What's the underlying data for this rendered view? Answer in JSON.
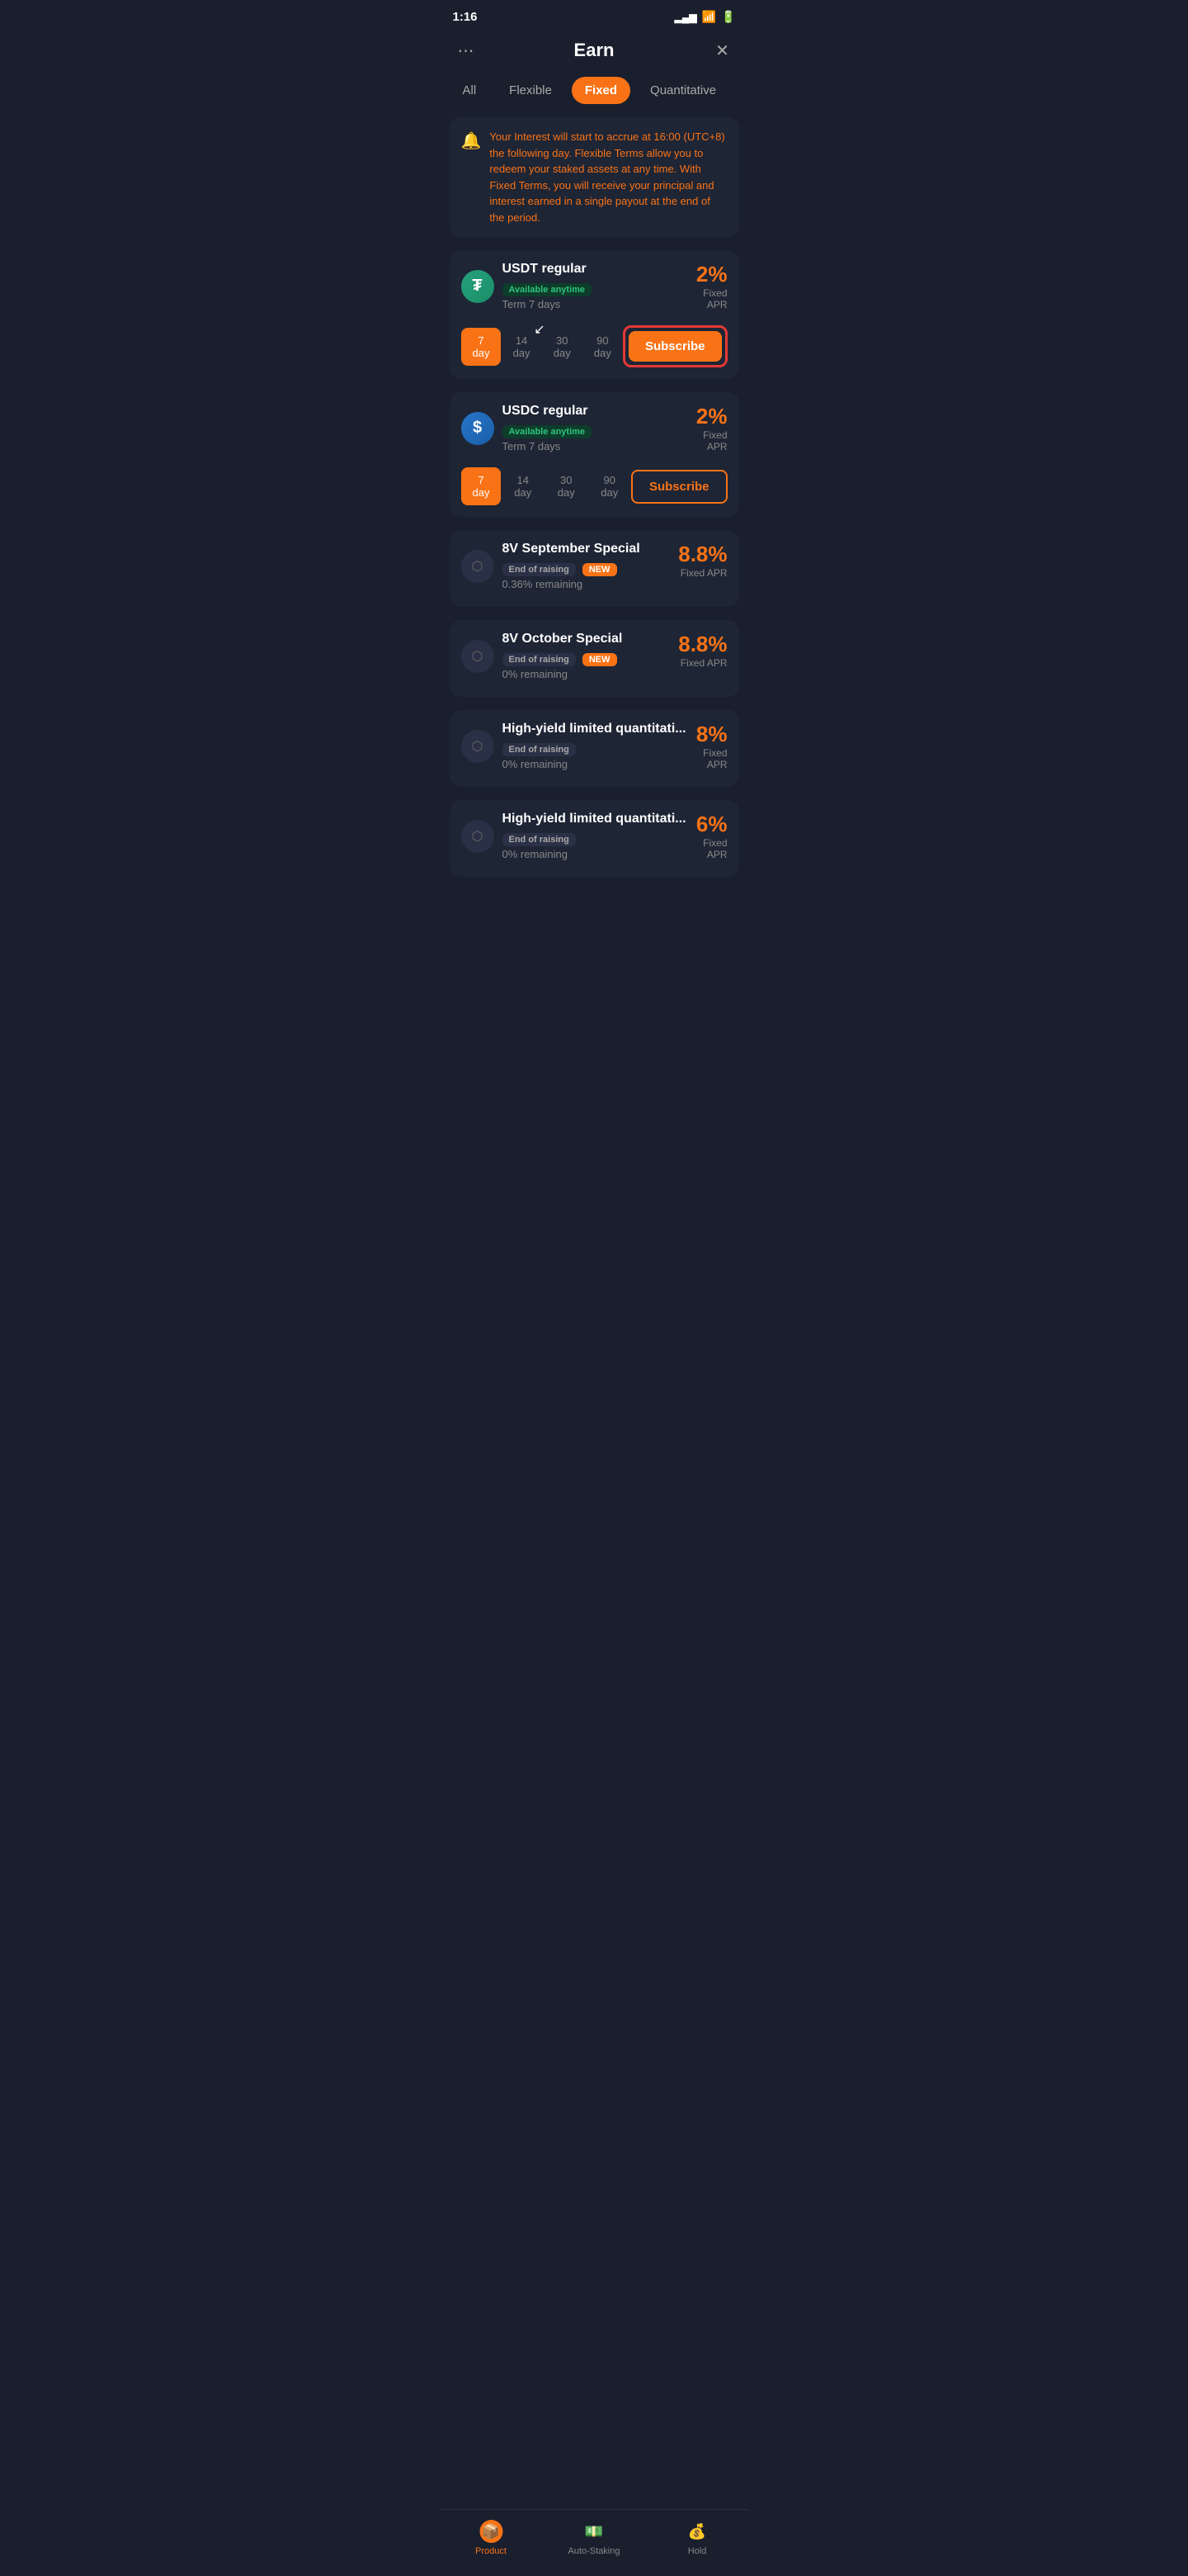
{
  "statusBar": {
    "time": "1:16",
    "icons": [
      "signal",
      "wifi",
      "battery"
    ]
  },
  "header": {
    "title": "Earn",
    "moreIcon": "⋯",
    "closeIcon": "✕"
  },
  "tabs": [
    {
      "id": "all",
      "label": "All",
      "active": false
    },
    {
      "id": "flexible",
      "label": "Flexible",
      "active": false
    },
    {
      "id": "fixed",
      "label": "Fixed",
      "active": true
    },
    {
      "id": "quantitative",
      "label": "Quantitative",
      "active": false
    }
  ],
  "notice": {
    "icon": "🔔",
    "text": "Your Interest will start to accrue at 16:00 (UTC+8) the following day. Flexible Terms allow you to redeem your staked assets at any time. With Fixed Terms, you will receive your principal and interest earned in a single payout at the end of the period."
  },
  "products": [
    {
      "id": "usdt-regular",
      "logo": "usdt",
      "name": "USDT regular",
      "badge": "Available anytime",
      "badgeType": "available",
      "apr": "2%",
      "aprLabel": "Fixed APR",
      "term": "Term 7 days",
      "days": [
        "7 day",
        "14 day",
        "30 day",
        "90 day"
      ],
      "activeDay": "7 day",
      "subscribeLabel": "Subscribe",
      "hasArrow": true,
      "highlighted": true
    },
    {
      "id": "usdc-regular",
      "logo": "usdc",
      "name": "USDC regular",
      "badge": "Available anytime",
      "badgeType": "available",
      "apr": "2%",
      "aprLabel": "Fixed APR",
      "term": "Term 7 days",
      "days": [
        "7 day",
        "14 day",
        "30 day",
        "90 day"
      ],
      "activeDay": "7 day",
      "subscribeLabel": "Subscribe",
      "hasArrow": false,
      "highlighted": false
    },
    {
      "id": "8v-september",
      "logo": "gray",
      "name": "8V September Special",
      "badge": "End of raising",
      "badgeType": "end",
      "newBadge": "NEW",
      "apr": "8.8%",
      "aprLabel": "Fixed APR",
      "remaining": "0.36% remaining",
      "hasDays": false
    },
    {
      "id": "8v-october",
      "logo": "gray",
      "name": "8V October Special",
      "badge": "End of raising",
      "badgeType": "end",
      "newBadge": "NEW",
      "apr": "8.8%",
      "aprLabel": "Fixed APR",
      "remaining": "0% remaining",
      "hasDays": false
    },
    {
      "id": "high-yield-1",
      "logo": "gray",
      "name": "High-yield limited quantitati...",
      "badge": "End of raising",
      "badgeType": "end",
      "apr": "8%",
      "aprLabel": "Fixed APR",
      "remaining": "0% remaining",
      "hasDays": false
    },
    {
      "id": "high-yield-2",
      "logo": "gray",
      "name": "High-yield limited quantitati...",
      "badge": "End of raising",
      "badgeType": "end",
      "apr": "6%",
      "aprLabel": "Fixed APR",
      "remaining": "0% remaining",
      "hasDays": false
    }
  ],
  "bottomNav": [
    {
      "id": "product",
      "icon": "📦",
      "label": "Product",
      "active": true
    },
    {
      "id": "auto-staking",
      "icon": "💵",
      "label": "Auto-Staking",
      "active": false
    },
    {
      "id": "hold",
      "icon": "💰",
      "label": "Hold",
      "active": false
    }
  ]
}
